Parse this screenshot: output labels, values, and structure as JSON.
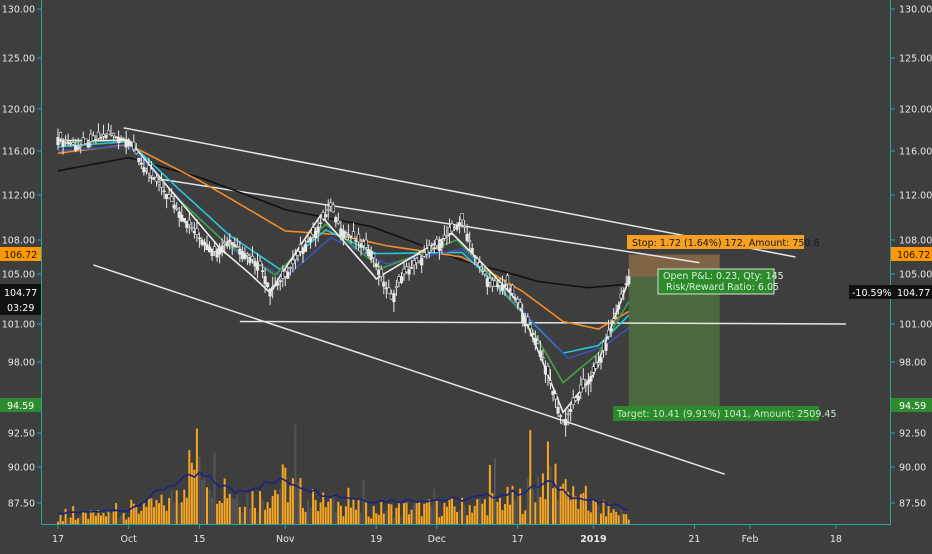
{
  "chart_data": {
    "type": "line",
    "chart_kind": "candlestick",
    "title": "",
    "xlabel": "",
    "ylabel": "",
    "ylim": [
      86,
      131
    ],
    "grid": false,
    "legend": "none",
    "y_ticks": [
      "130.00",
      "125.00",
      "120.00",
      "116.00",
      "112.00",
      "108.00",
      "105.00",
      "101.00",
      "98.00",
      "92.50",
      "90.00",
      "87.50"
    ],
    "y_tick_values": [
      130,
      125,
      120,
      116,
      112,
      108,
      105,
      101,
      98,
      92.5,
      90,
      87.5
    ],
    "x_ticks": [
      {
        "label": "17",
        "day": 0,
        "bold": false
      },
      {
        "label": "Oct",
        "day": 14,
        "bold": false
      },
      {
        "label": "15",
        "day": 28,
        "bold": false
      },
      {
        "label": "Nov",
        "day": 45,
        "bold": false
      },
      {
        "label": "19",
        "day": 63,
        "bold": false
      },
      {
        "label": "Dec",
        "day": 75,
        "bold": false
      },
      {
        "label": "17",
        "day": 91,
        "bold": false
      },
      {
        "label": "2019",
        "day": 106,
        "bold": true
      },
      {
        "label": "21",
        "day": 126,
        "bold": false
      },
      {
        "label": "Feb",
        "day": 137,
        "bold": false
      },
      {
        "label": "18",
        "day": 154,
        "bold": false
      }
    ],
    "x_range": [
      -3,
      163
    ],
    "price_path": [
      [
        0,
        117.3
      ],
      [
        4,
        116.4
      ],
      [
        8,
        117.2
      ],
      [
        10,
        117.6
      ],
      [
        14,
        117.0
      ],
      [
        17,
        114.5
      ],
      [
        20,
        113.0
      ],
      [
        24,
        110.5
      ],
      [
        28,
        108.2
      ],
      [
        31,
        107.0
      ],
      [
        34,
        108.0
      ],
      [
        37,
        106.8
      ],
      [
        40,
        105.8
      ],
      [
        42,
        103.8
      ],
      [
        45,
        104.8
      ],
      [
        48,
        107.0
      ],
      [
        51,
        108.8
      ],
      [
        54,
        111.0
      ],
      [
        56,
        109.0
      ],
      [
        59,
        108.0
      ],
      [
        62,
        107.0
      ],
      [
        64,
        104.8
      ],
      [
        66,
        103.0
      ],
      [
        68,
        104.8
      ],
      [
        71,
        106.0
      ],
      [
        75,
        107.5
      ],
      [
        78,
        108.8
      ],
      [
        80,
        109.8
      ],
      [
        83,
        106.0
      ],
      [
        86,
        104.0
      ],
      [
        89,
        104.2
      ],
      [
        91,
        102.7
      ],
      [
        93,
        101.0
      ],
      [
        95,
        99.5
      ],
      [
        97,
        97.0
      ],
      [
        99,
        94.5
      ],
      [
        100,
        93.2
      ],
      [
        102,
        94.7
      ],
      [
        104,
        96.0
      ],
      [
        107,
        97.8
      ],
      [
        109,
        100.0
      ],
      [
        111,
        102.5
      ],
      [
        113,
        104.8
      ]
    ],
    "series": [
      {
        "name": "",
        "color": "#111111",
        "values": [
          [
            0,
            114.2
          ],
          [
            14,
            115.4
          ],
          [
            28,
            113.6
          ],
          [
            45,
            110.7
          ],
          [
            62,
            109.2
          ],
          [
            80,
            106.2
          ],
          [
            95,
            104.4
          ],
          [
            105,
            103.9
          ],
          [
            113,
            104.2
          ]
        ]
      },
      {
        "name": "",
        "color": "#f28c28",
        "values": [
          [
            0,
            115.8
          ],
          [
            14,
            116.6
          ],
          [
            28,
            113.3
          ],
          [
            45,
            108.8
          ],
          [
            55,
            108.5
          ],
          [
            65,
            107.5
          ],
          [
            80,
            106.5
          ],
          [
            92,
            103.6
          ],
          [
            100,
            101.2
          ],
          [
            107,
            100.6
          ],
          [
            113,
            102.0
          ]
        ]
      },
      {
        "name": "",
        "color": "#26c6da",
        "values": [
          [
            0,
            116.4
          ],
          [
            14,
            116.9
          ],
          [
            24,
            112.5
          ],
          [
            34,
            108.4
          ],
          [
            44,
            105.4
          ],
          [
            53,
            108.9
          ],
          [
            63,
            106.8
          ],
          [
            80,
            106.9
          ],
          [
            93,
            101.5
          ],
          [
            100,
            98.7
          ],
          [
            107,
            99.3
          ],
          [
            113,
            101.7
          ]
        ]
      },
      {
        "name": "",
        "color": "#3f51b5",
        "values": [
          [
            0,
            116.0
          ],
          [
            14,
            116.5
          ],
          [
            25,
            111.2
          ],
          [
            35,
            107.0
          ],
          [
            45,
            104.7
          ],
          [
            54,
            108.2
          ],
          [
            65,
            105.9
          ],
          [
            80,
            107.2
          ],
          [
            93,
            101.6
          ],
          [
            101,
            98.3
          ],
          [
            108,
            99.2
          ],
          [
            113,
            100.7
          ]
        ]
      },
      {
        "name": "",
        "color": "#43a047",
        "values": [
          [
            0,
            116.7
          ],
          [
            14,
            117.1
          ],
          [
            23,
            112.0
          ],
          [
            33,
            107.8
          ],
          [
            43,
            104.9
          ],
          [
            53,
            109.4
          ],
          [
            64,
            105.5
          ],
          [
            79,
            108.0
          ],
          [
            92,
            101.8
          ],
          [
            100,
            96.4
          ],
          [
            107,
            98.7
          ],
          [
            113,
            102.8
          ]
        ]
      },
      {
        "name": "",
        "color": "#eeeeee",
        "values": [
          [
            0,
            117.0
          ],
          [
            14,
            117.0
          ],
          [
            22,
            112.6
          ],
          [
            32,
            107.3
          ],
          [
            42,
            103.5
          ],
          [
            52,
            110.2
          ],
          [
            63,
            104.6
          ],
          [
            78,
            108.6
          ],
          [
            91,
            102.8
          ],
          [
            100,
            94.1
          ],
          [
            106,
            97.0
          ],
          [
            113,
            104.5
          ]
        ]
      }
    ],
    "trendlines": [
      {
        "from": [
          13,
          118.2
        ],
        "to": [
          146,
          106.5
        ]
      },
      {
        "from": [
          18,
          113.6
        ],
        "to": [
          127,
          106.0
        ]
      },
      {
        "from": [
          36,
          101.2
        ],
        "to": [
          156,
          101.0
        ]
      },
      {
        "from": [
          7,
          105.8
        ],
        "to": [
          132,
          89.5
        ]
      }
    ],
    "volume_axis_max": 100,
    "volume_profile": [
      [
        0,
        5
      ],
      [
        14,
        10
      ],
      [
        22,
        18
      ],
      [
        28,
        60
      ],
      [
        35,
        25
      ],
      [
        40,
        22
      ],
      [
        45,
        35
      ],
      [
        50,
        20
      ],
      [
        62,
        12
      ],
      [
        80,
        15
      ],
      [
        92,
        22
      ],
      [
        97,
        45
      ],
      [
        103,
        18
      ],
      [
        113,
        8
      ]
    ],
    "volume_ma": [
      [
        0,
        8
      ],
      [
        14,
        11
      ],
      [
        22,
        30
      ],
      [
        28,
        38
      ],
      [
        35,
        25
      ],
      [
        40,
        30
      ],
      [
        45,
        34
      ],
      [
        52,
        24
      ],
      [
        62,
        18
      ],
      [
        80,
        19
      ],
      [
        92,
        25
      ],
      [
        97,
        32
      ],
      [
        103,
        20
      ],
      [
        113,
        12
      ]
    ],
    "position": {
      "x_start": 113,
      "x_end": 131,
      "entry": 104.77,
      "stop": 106.72,
      "target": 94.59,
      "stop_label": "Stop: 1.72 (1.64%) 172, Amount: 750.6",
      "target_label": "Target: 10.41 (9.91%) 1041, Amount: 2509.45",
      "pnl_label": "Open P&L: 0.23, Qty: 145",
      "rr_label": "Risk/Reward Ratio: 6.05"
    },
    "price_tags": {
      "stop": "106.72",
      "current": "104.77",
      "countdown": "03:29",
      "target": "94.59",
      "change": "-10.59%"
    },
    "colors": {
      "background": "#3e3e3e",
      "axis": "#26a69a",
      "candle": "#e8e8e8",
      "volume": "#f5a623",
      "volume_ma": "#1a237e",
      "stop_zone": "#8b6b48",
      "target_zone": "#4d6d3e",
      "stop_tag": "#ff9800",
      "target_tag": "#2e8b2e",
      "trendline": "#e6e6e6"
    }
  }
}
